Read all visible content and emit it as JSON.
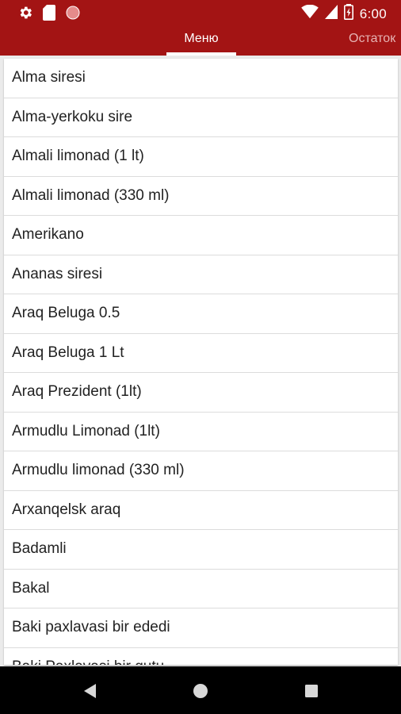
{
  "colors": {
    "accent": "#a31414",
    "tab_inactive": "#e6b3b3",
    "list_bg": "#ffffff",
    "divider": "#dcdcdc",
    "nav_bg": "#000000"
  },
  "status_bar": {
    "icons_left": [
      "gear-icon",
      "sd-card-icon",
      "record-icon"
    ],
    "icons_right": [
      "wifi-icon",
      "cellular-icon",
      "battery-icon"
    ],
    "time": "6:00"
  },
  "tabs": [
    {
      "label": "Меню",
      "active": true
    },
    {
      "label": "Остаток",
      "active": false
    }
  ],
  "menu_items": [
    "Alma siresi",
    "Alma-yerkoku sire",
    "Almali limonad (1 lt)",
    "Almali limonad (330 ml)",
    "Amerikano",
    "Ananas siresi",
    "Araq Beluga 0.5",
    "Araq Beluga 1 Lt",
    "Araq Prezident (1lt)",
    "Armudlu Limonad (1lt)",
    "Armudlu limonad (330 ml)",
    "Arxanqelsk araq",
    "Badamli",
    "Bakal",
    "Baki paxlavasi bir ededi",
    "Baki Paxlavasi bir qutu"
  ],
  "nav_bar": {
    "buttons": [
      "back-icon",
      "home-icon",
      "recents-icon"
    ]
  }
}
